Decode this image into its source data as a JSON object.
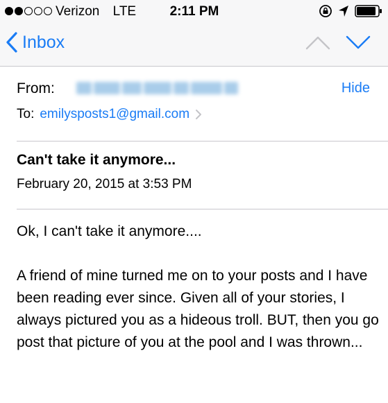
{
  "status_bar": {
    "carrier": "Verizon",
    "network": "LTE",
    "time": "2:11 PM",
    "signal_strength": 2,
    "signal_total": 5
  },
  "nav": {
    "back_label": "Inbox",
    "accent_color": "#1a7cf5"
  },
  "email": {
    "from_label": "From:",
    "hide_label": "Hide",
    "to_label": "To:",
    "to_address": "emilysposts1@gmail.com",
    "subject": "Can't take it anymore...",
    "date": "February 20, 2015 at 3:53 PM",
    "body": [
      "Ok, I can't take it anymore....",
      "A friend of mine turned me on to your posts and I have been reading ever since.  Given all of your stories, I always pictured you as a hideous troll.  BUT, then you go post that picture of you at the pool and I was thrown..."
    ]
  },
  "icons": {
    "back": "chevron-left-icon",
    "previous": "chevron-up-icon",
    "next": "chevron-down-icon",
    "rotation_lock": "rotation-lock-icon",
    "location": "location-arrow-icon",
    "battery": "battery-icon"
  }
}
